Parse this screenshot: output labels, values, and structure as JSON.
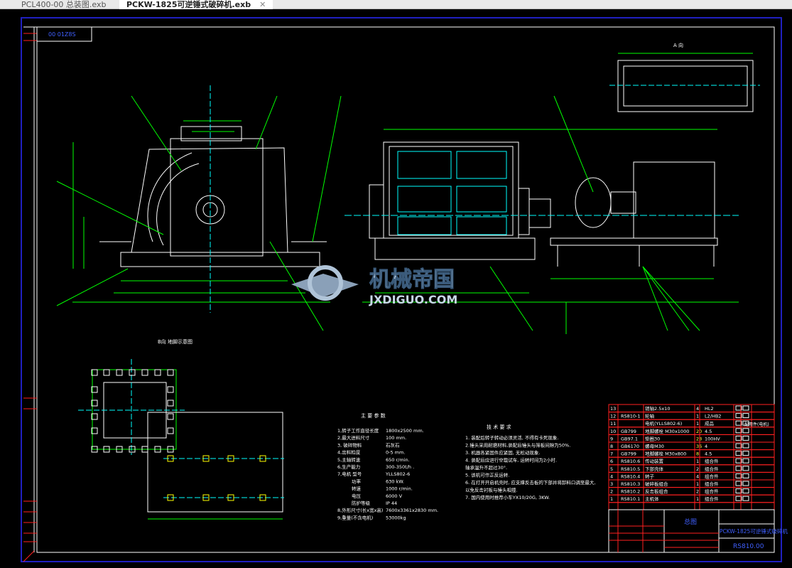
{
  "tabs": [
    {
      "label": "PCL400-00 总装图.exb",
      "active": false
    },
    {
      "label": "PCKW-1825可逆锤式破碎机.exb",
      "active": true
    }
  ],
  "drawing_code_box": "00 01Z8S",
  "view_labels": {
    "a_view": "A 向",
    "foundation": "B向 地脚示意图"
  },
  "watermark": {
    "name": "机械帝国",
    "url": "JXDIGUO.COM"
  },
  "specs": {
    "title": "主 要 参 数",
    "rows": [
      [
        "1,转子工作直径长度",
        "1800x2500 mm."
      ],
      [
        "2,最大进料尺寸",
        "100  mm."
      ],
      [
        "3, 破碎物料",
        "石灰石"
      ],
      [
        "4,出料粒度",
        "0-5  mm."
      ],
      [
        "5,主轴转速",
        "650  r/min."
      ],
      [
        "6,生产能力",
        "300-350t/h ."
      ],
      [
        "7,电机  型号",
        "YLLS802-6"
      ],
      [
        "功率",
        "630  kW."
      ],
      [
        "转速",
        "1000  r/min."
      ],
      [
        "电压",
        "6000  V"
      ],
      [
        "防护等级",
        "IP 44"
      ],
      [
        "8,外形尺寸(长x宽x高)",
        "7600x3361x2830 mm."
      ],
      [
        "9,重量(不含电机)",
        "53000kg"
      ]
    ]
  },
  "requirements": {
    "title": "技 术 要 求",
    "items": [
      "1. 装配后转子转动必须灵活, 不得有卡死现象.",
      "2.锤头采用耐磨材料,装配后锤头与筛板间隙为50%.",
      "3. 机器各紧固件应紧固, 无松动现象.",
      "4. 装配后应进行空载试车, 运转时间为2小时.",
      "   轴承温升不超过30°.",
      "5. 该机可作正反运转.",
      "6. 在打开开启机壳时, 应支撑反击板的下部并将卸料口调至最大,",
      "   以免反击衬板与锤头相撞.",
      "7. 国内使用时推荐小车YX10/20G, 3KW."
    ]
  },
  "parts_table": {
    "rows": [
      [
        "13",
        "",
        "销轴2.5x10",
        "4",
        "HL2"
      ],
      [
        "12",
        "RS810-1",
        "轮轴",
        "1",
        "L2/HB2"
      ],
      [
        "11",
        "",
        "电机(YLLS802-6)",
        "1",
        "成品"
      ],
      [
        "10",
        "GB799",
        "地脚螺栓 M30x1000",
        "20",
        "4.5"
      ],
      [
        "9",
        "GB97.1",
        "垫圈30",
        "28",
        "100HV"
      ],
      [
        "8",
        "GB6170",
        "螺母M30",
        "36",
        "4"
      ],
      [
        "7",
        "GB799",
        "地脚螺栓 M30x800",
        "8",
        "4.5"
      ],
      [
        "6",
        "RS810.6",
        "传动装置",
        "1",
        "组合件"
      ],
      [
        "5",
        "RS810.5",
        "下部壳体",
        "2",
        "组合件"
      ],
      [
        "4",
        "RS810.4",
        "转子",
        "4",
        "组合件"
      ],
      [
        "3",
        "RS810.3",
        "破碎板组合",
        "1",
        "组合件"
      ],
      [
        "2",
        "RS810.2",
        "反击板组合",
        "2",
        "组合件"
      ],
      [
        "1",
        "RS810.1",
        "主机体",
        "1",
        "组合件"
      ]
    ],
    "side_note": "配用件(电机)"
  },
  "title_block": {
    "drawing_name": "总图",
    "product": "PCKW-1825可逆锤式破碎机",
    "code": "RS810.00"
  },
  "colors": {
    "frame_outer": "#2020c0",
    "frame": "#ffffff",
    "geometry": "#ffffff",
    "dimension": "#00ff00",
    "centerline": "#00ffff",
    "table": "#ff2020",
    "text_blue": "#4060ff",
    "leader": "#00ff00"
  }
}
